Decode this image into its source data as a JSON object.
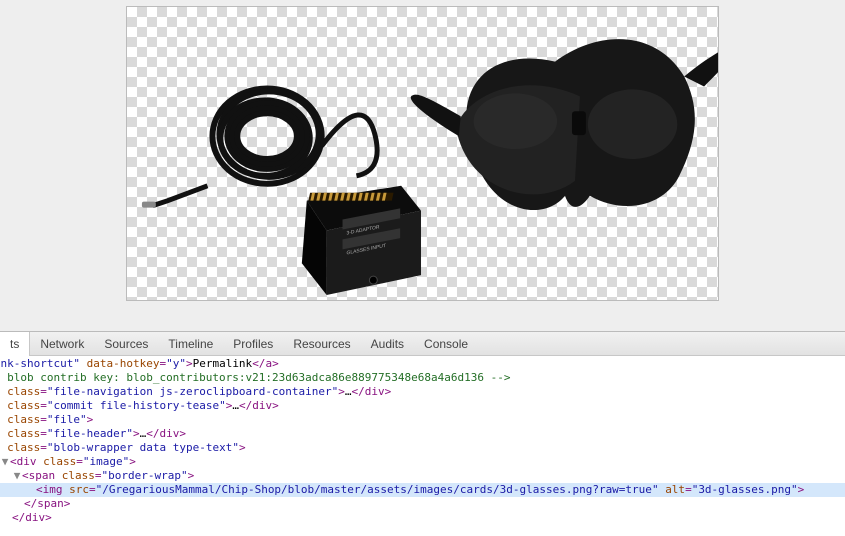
{
  "devtools": {
    "tabs": [
      "ts",
      "Network",
      "Sources",
      "Timeline",
      "Profiles",
      "Resources",
      "Audits",
      "Console"
    ],
    "active_tab_index": 0
  },
  "dom": {
    "line1": {
      "frag_attr_name1": "malink-shortcut",
      "attr_name2": "data-hotkey",
      "attr_val2": "y",
      "text": "Permalink",
      "close_tag": "a"
    },
    "line2": {
      "comment": "  blob contrib key: blob_contributors:v21:23d63adca86e889775348e68a4a6d136 "
    },
    "line3": {
      "tag": "div",
      "attr": "class",
      "val": "file-navigation js-zeroclipboard-container",
      "ellipsis": "…"
    },
    "line4": {
      "tag": "div",
      "attr": "class",
      "val": "commit file-history-tease",
      "ellipsis": "…"
    },
    "line5": {
      "tag": "div",
      "attr": "class",
      "val": "file"
    },
    "line6": {
      "tag": "div",
      "attr": "class",
      "val": "file-header",
      "ellipsis": "…"
    },
    "line7": {
      "tag": "div",
      "attr": "class",
      "val": "blob-wrapper data type-text"
    },
    "line8": {
      "tag": "div",
      "attr": "class",
      "val": "image"
    },
    "line9": {
      "tag": "span",
      "attr": "class",
      "val": "border-wrap"
    },
    "line10": {
      "tag": "img",
      "src_attr": "src",
      "src_val": "/GregariousMammal/Chip-Shop/blob/master/assets/images/cards/3d-glasses.png?raw=true",
      "alt_attr": "alt",
      "alt_val": "3d-glasses.png"
    },
    "line11": {
      "close_tag": "span"
    },
    "line12": {
      "close_tag": "div"
    }
  },
  "image": {
    "alt": "3d-glasses.png"
  }
}
